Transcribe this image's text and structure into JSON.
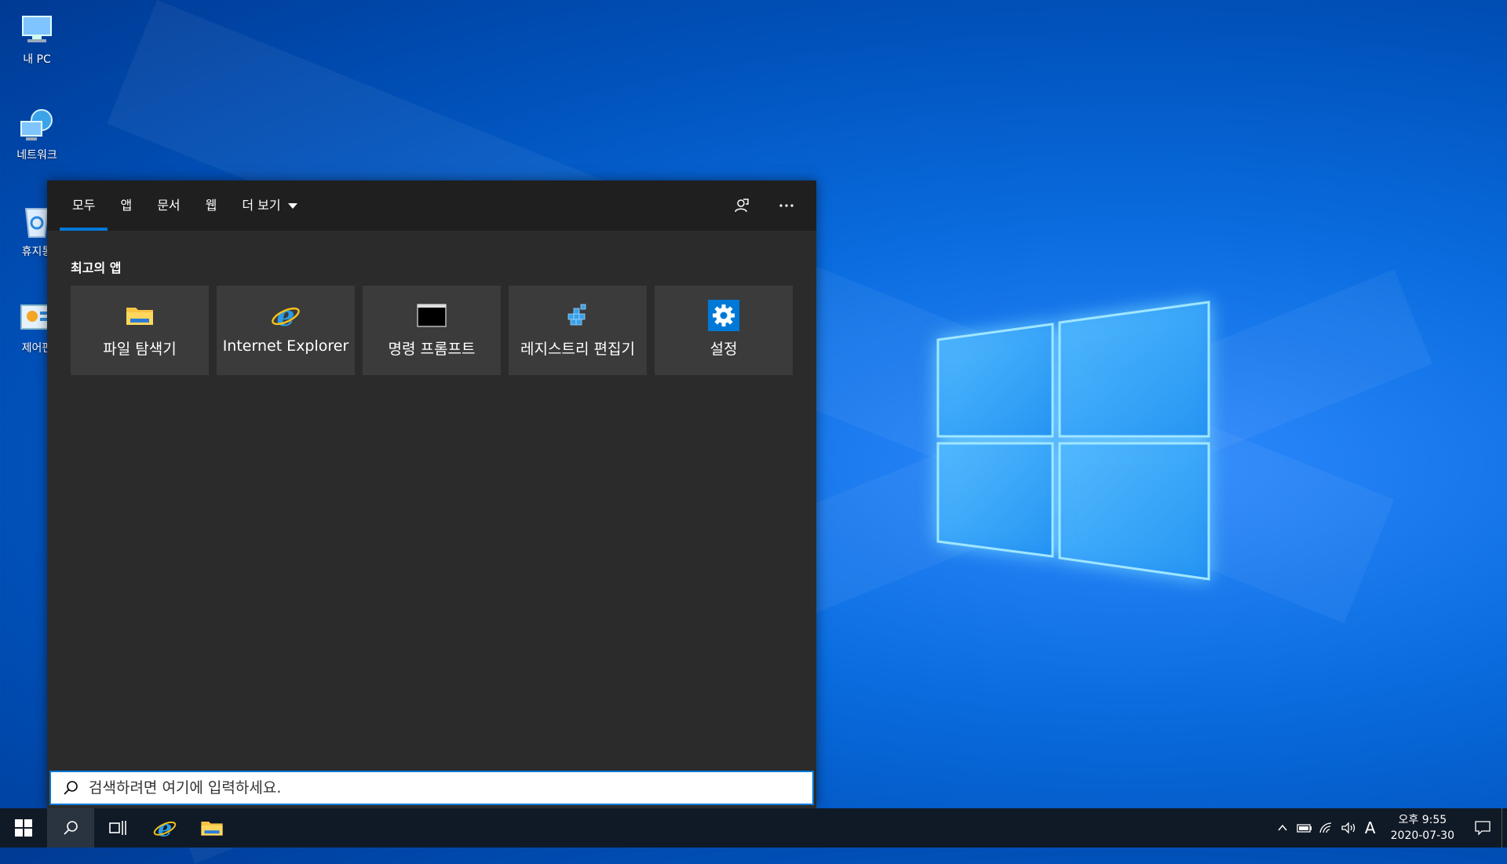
{
  "desktop": {
    "icons": [
      {
        "label": "내 PC",
        "icon": "computer-icon"
      },
      {
        "label": "네트워크",
        "icon": "network-icon"
      },
      {
        "label": "휴지통",
        "icon": "recycle-bin-icon"
      },
      {
        "label": "제어판",
        "icon": "control-panel-icon"
      }
    ]
  },
  "search_panel": {
    "tabs": [
      {
        "label": "모두",
        "active": true
      },
      {
        "label": "앱"
      },
      {
        "label": "문서"
      },
      {
        "label": "웹"
      },
      {
        "label": "더 보기"
      }
    ],
    "section_title": "최고의 앱",
    "top_apps": [
      {
        "label": "파일 탐색기",
        "icon": "file-explorer-icon"
      },
      {
        "label": "Internet Explorer",
        "icon": "internet-explorer-icon"
      },
      {
        "label": "명령 프롬프트",
        "icon": "command-prompt-icon"
      },
      {
        "label": "레지스트리 편집기",
        "icon": "registry-editor-icon"
      },
      {
        "label": "설정",
        "icon": "settings-gear-icon"
      }
    ],
    "search_placeholder": "검색하려면 여기에 입력하세요."
  },
  "taskbar": {
    "clock_time": "오후 9:55",
    "clock_date": "2020-07-30",
    "ime_label": "A"
  },
  "colors": {
    "accent": "#0078d7",
    "panel_bg": "#2b2b2b",
    "tile_bg": "#3b3b3b",
    "taskbar_bg": "#101a26"
  }
}
